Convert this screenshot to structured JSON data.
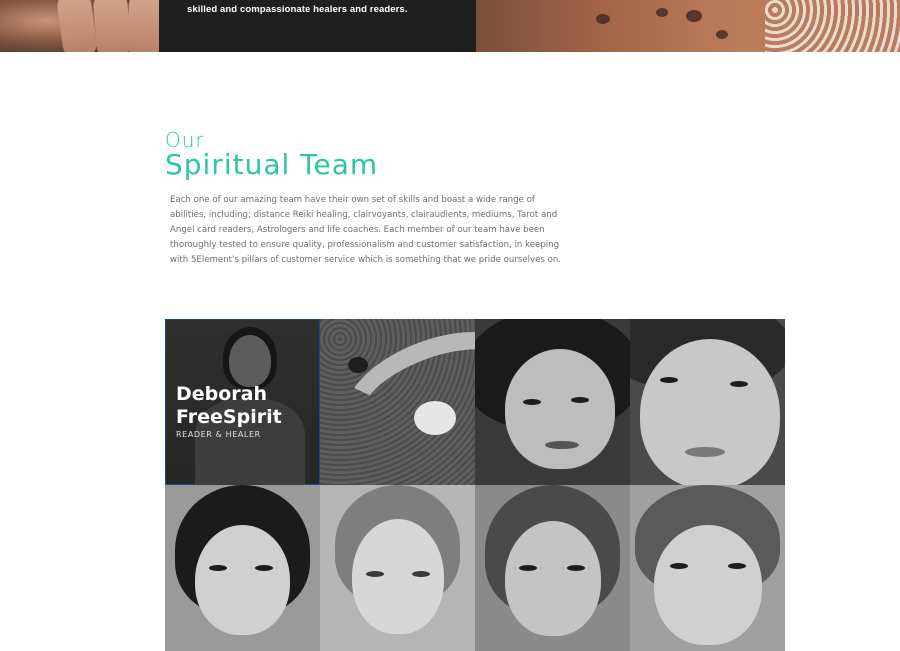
{
  "banner": {
    "tagline": "skilled and compassionate healers and readers."
  },
  "section": {
    "heading_small": "Our",
    "heading_large": "Spiritual Team",
    "intro": "Each one of our amazing team have their own set of skills and boast a wide range of abilities, including; distance Reiki healing, clairvoyants, clairaudients, mediums, Tarot and Angel card readers, Astrologers and life coaches. Each member of our team have been thoroughly tested to ensure quality, professionalism and customer satisfaction, in keeping with 5Element's pillars of customer service which is something that we pride ourselves on."
  },
  "team": [
    {
      "name": "Deborah FreeSpirit",
      "role": "READER & HEALER",
      "photo": "team-member-photo"
    },
    {
      "photo": "zen-garden-photo"
    },
    {
      "photo": "team-member-photo"
    },
    {
      "photo": "team-member-photo"
    },
    {
      "photo": "team-member-photo"
    },
    {
      "photo": "team-member-photo"
    },
    {
      "photo": "team-member-photo"
    },
    {
      "photo": "team-member-photo"
    }
  ],
  "colors": {
    "accent": "#2ec4a4",
    "banner_dark": "#1f1f1f",
    "body_text": "#6e6e6e"
  }
}
